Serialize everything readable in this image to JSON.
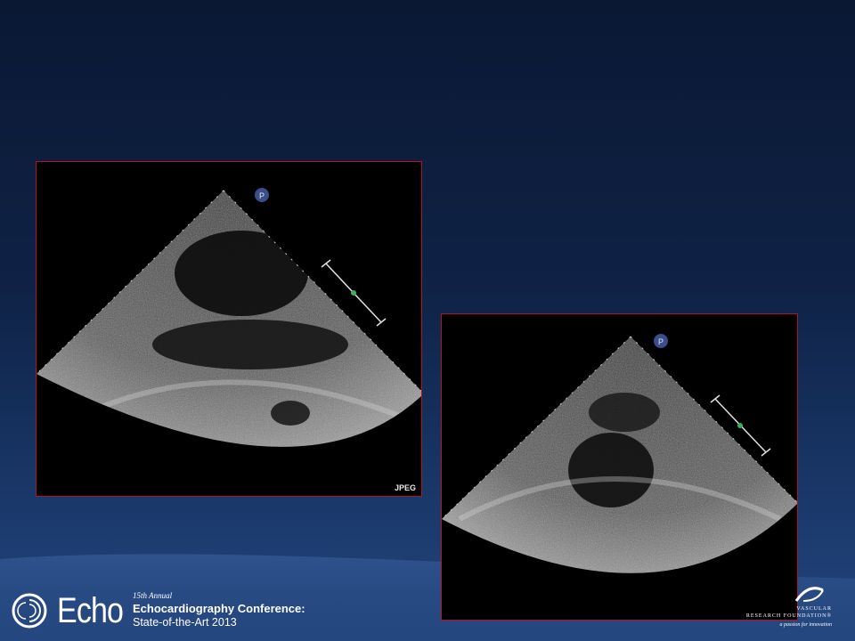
{
  "slide": {
    "images": [
      {
        "badge": "P",
        "tag": "JPEG"
      },
      {
        "badge": "P",
        "tag": ""
      }
    ]
  },
  "footer": {
    "brand": "Echo",
    "annual": "15th Annual",
    "title": "Echocardiography Conference:",
    "subtitle": "State-of-the-Art 2013",
    "sponsor_line1": "VASCULAR",
    "sponsor_line2": "RESEARCH FOUNDATION®",
    "sponsor_tagline": "a passion for innovation"
  },
  "colors": {
    "frame_border": "#b0122a",
    "background_top": "#0a1833",
    "background_bottom": "#24467f"
  }
}
